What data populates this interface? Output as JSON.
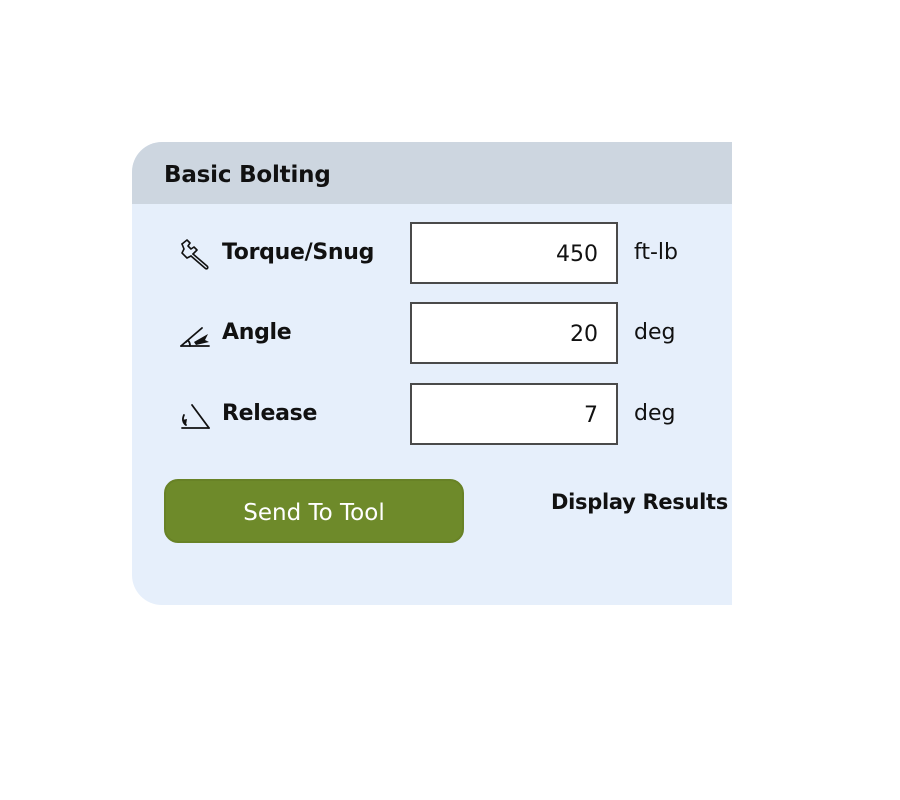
{
  "panel": {
    "title": "Basic Bolting",
    "rows": [
      {
        "label": "Torque/Snug",
        "icon": "wrench-icon",
        "value": "450",
        "unit": "ft-lb"
      },
      {
        "label": "Angle",
        "icon": "angle-icon",
        "value": "20",
        "unit": "deg"
      },
      {
        "label": "Release",
        "icon": "release-icon",
        "value": "7",
        "unit": "deg"
      }
    ],
    "send_button_label": "Send To Tool",
    "display_results_label": "Display Results"
  },
  "colors": {
    "panel_background": "#e6effb",
    "header_background": "#cdd6e0",
    "button_green": "#6e8a2a"
  }
}
